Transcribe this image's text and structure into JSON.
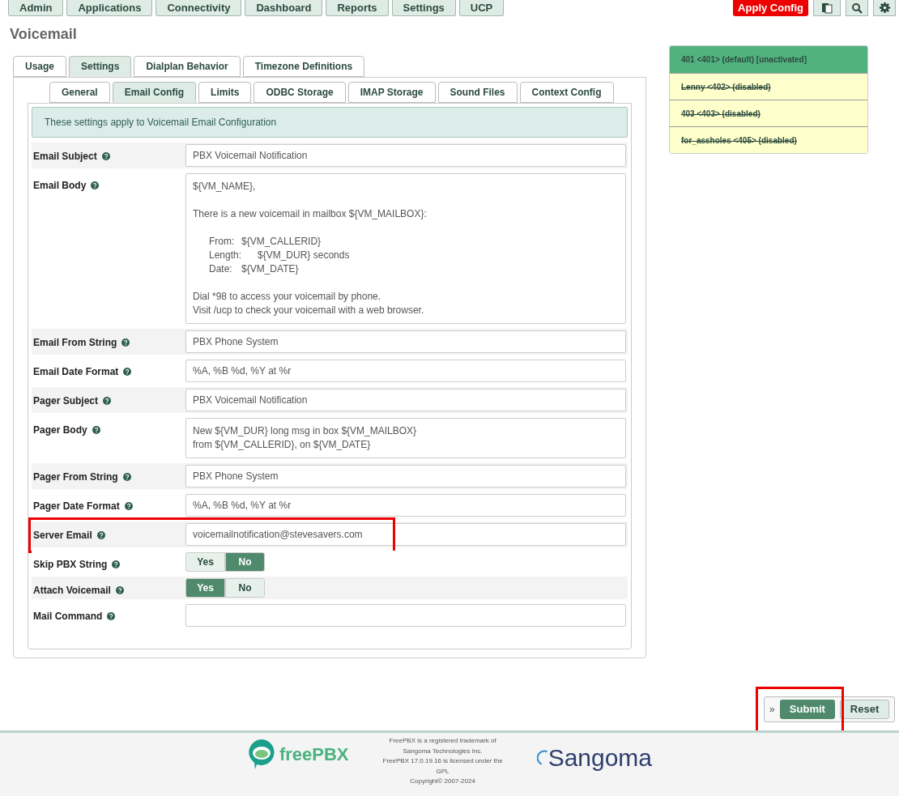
{
  "nav": {
    "items": [
      {
        "label": "Admin"
      },
      {
        "label": "Applications"
      },
      {
        "label": "Connectivity"
      },
      {
        "label": "Dashboard"
      },
      {
        "label": "Reports"
      },
      {
        "label": "Settings"
      },
      {
        "label": "UCP"
      }
    ],
    "apply_config": "Apply Config"
  },
  "page_title": "Voicemail",
  "tabs": [
    {
      "label": "Usage",
      "selected": false
    },
    {
      "label": "Settings",
      "selected": true
    },
    {
      "label": "Dialplan Behavior",
      "selected": false
    },
    {
      "label": "Timezone Definitions",
      "selected": false
    }
  ],
  "subtabs": [
    {
      "label": "General",
      "selected": false
    },
    {
      "label": "Email Config",
      "selected": true
    },
    {
      "label": "Limits",
      "selected": false
    },
    {
      "label": "ODBC Storage",
      "selected": false
    },
    {
      "label": "IMAP Storage",
      "selected": false
    },
    {
      "label": "Sound Files",
      "selected": false
    },
    {
      "label": "Context Config",
      "selected": false
    }
  ],
  "notice": "These settings apply to Voicemail Email Configuration",
  "fields": [
    {
      "kind": "input",
      "label": "Email Subject",
      "value": "PBX Voicemail Notification"
    },
    {
      "kind": "textarea",
      "label": "Email Body",
      "value": "${VM_NAME},\n\nThere is a new voicemail in mailbox ${VM_MAILBOX}:\n\n\tFrom:\t${VM_CALLERID}\n\tLength:\t${VM_DUR} seconds\n\tDate:\t${VM_DATE}\n\nDial *98 to access your voicemail by phone.\nVisit /ucp to check your voicemail with a web browser.\n"
    },
    {
      "kind": "input",
      "label": "Email From String",
      "value": "PBX Phone System"
    },
    {
      "kind": "input",
      "label": "Email Date Format",
      "value": "%A, %B %d, %Y at %r"
    },
    {
      "kind": "input",
      "label": "Pager Subject",
      "value": "PBX Voicemail Notification"
    },
    {
      "kind": "textarea",
      "label": "Pager Body",
      "value": "New ${VM_DUR} long msg in box ${VM_MAILBOX}\nfrom ${VM_CALLERID}, on ${VM_DATE}"
    },
    {
      "kind": "input",
      "label": "Pager From String",
      "value": "PBX Phone System"
    },
    {
      "kind": "input",
      "label": "Pager Date Format",
      "value": "%A, %B %d, %Y at %r"
    },
    {
      "kind": "input",
      "label": "Server Email",
      "value": "voicemailnotification@stevesavers.com",
      "highlighted": true
    },
    {
      "kind": "toggle",
      "label": "Skip PBX String",
      "options": [
        {
          "label": "Yes",
          "selected": false
        },
        {
          "label": "No",
          "selected": true
        }
      ]
    },
    {
      "kind": "toggle",
      "label": "Attach Voicemail",
      "options": [
        {
          "label": "Yes",
          "selected": true
        },
        {
          "label": "No",
          "selected": false
        }
      ]
    },
    {
      "kind": "input",
      "label": "Mail Command"
    }
  ],
  "mailboxes": [
    {
      "label": "401 <401>  (default) [unactivated]",
      "selected": true,
      "disabled": false
    },
    {
      "label": "Lenny <402>  (disabled)",
      "selected": false,
      "disabled": true
    },
    {
      "label": "403 <403>  (disabled)",
      "selected": false,
      "disabled": true
    },
    {
      "label": "for_assholes <405>  (disabled)",
      "selected": false,
      "disabled": true
    }
  ],
  "actions": {
    "expand": "»",
    "submit": "Submit",
    "reset": "Reset",
    "highlighted": true
  },
  "footer": {
    "logo_left": "freePBX",
    "lines": [
      "FreePBX is a registered trademark of",
      "Sangoma Technologies Inc.",
      "FreePBX 17.0.19.16 is licensed under the",
      "GPL",
      "Copyright© 2007-2024"
    ],
    "logo_right": "Sangoma"
  }
}
